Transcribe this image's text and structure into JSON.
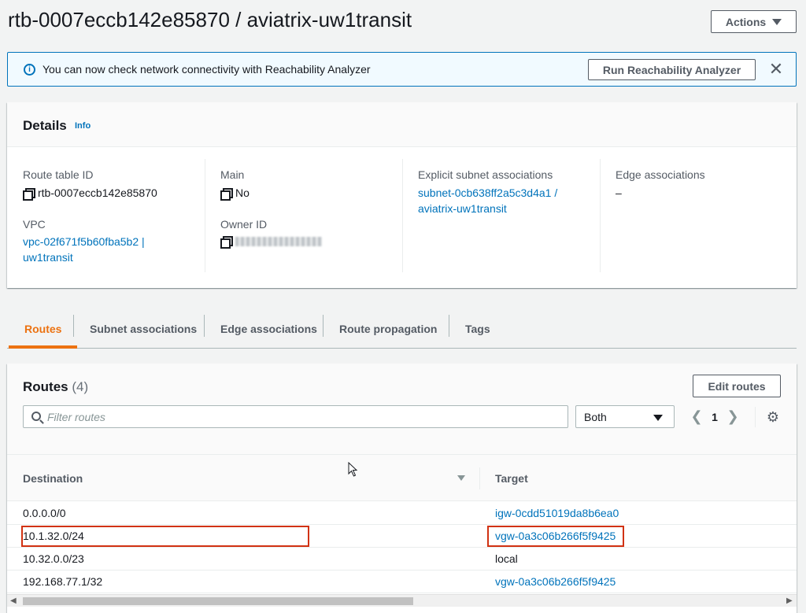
{
  "page": {
    "title": "rtb-0007eccb142e85870 / aviatrix-uw1transit",
    "actions_label": "Actions"
  },
  "flash": {
    "message": "You can now check network connectivity with Reachability Analyzer",
    "button_label": "Run Reachability Analyzer",
    "close_symbol": "✕"
  },
  "details": {
    "title": "Details",
    "info_label": "Info",
    "route_table_id": {
      "label": "Route table ID",
      "value": "rtb-0007eccb142e85870"
    },
    "vpc": {
      "label": "VPC",
      "line1": "vpc-02f671f5b60fba5b2 |",
      "line2": "uw1transit"
    },
    "main": {
      "label": "Main",
      "value": "No"
    },
    "owner_id": {
      "label": "Owner ID"
    },
    "explicit_subnet": {
      "label": "Explicit subnet associations",
      "line1": "subnet-0cb638ff2a5c3d4a1 /",
      "line2": "aviatrix-uw1transit"
    },
    "edge": {
      "label": "Edge associations",
      "value": "–"
    }
  },
  "tabs": [
    {
      "label": "Routes",
      "active": true
    },
    {
      "label": "Subnet associations",
      "active": false
    },
    {
      "label": "Edge associations",
      "active": false
    },
    {
      "label": "Route propagation",
      "active": false
    },
    {
      "label": "Tags",
      "active": false
    }
  ],
  "routes": {
    "title": "Routes",
    "count": "(4)",
    "edit_label": "Edit routes",
    "filter_placeholder": "Filter routes",
    "select_value": "Both",
    "page_number": "1",
    "columns": {
      "destination": "Destination",
      "target": "Target"
    },
    "rows": [
      {
        "destination": "0.0.0.0/0",
        "target": "igw-0cdd51019da8b6ea0",
        "target_is_link": true
      },
      {
        "destination": "10.1.32.0/24",
        "target": "vgw-0a3c06b266f5f9425",
        "target_is_link": true,
        "highlighted": true
      },
      {
        "destination": "10.32.0.0/23",
        "target": "local",
        "target_is_link": false
      },
      {
        "destination": "192.168.77.1/32",
        "target": "vgw-0a3c06b266f5f9425",
        "target_is_link": true
      }
    ]
  },
  "colors": {
    "link": "#0073bb",
    "active_tab": "#ec7211",
    "highlight": "#d13212"
  },
  "icons": {
    "info": "info-circle-icon",
    "copy": "copy-icon",
    "search": "search-icon",
    "settings": "gear-icon",
    "cursor": "mouse-pointer-icon"
  }
}
